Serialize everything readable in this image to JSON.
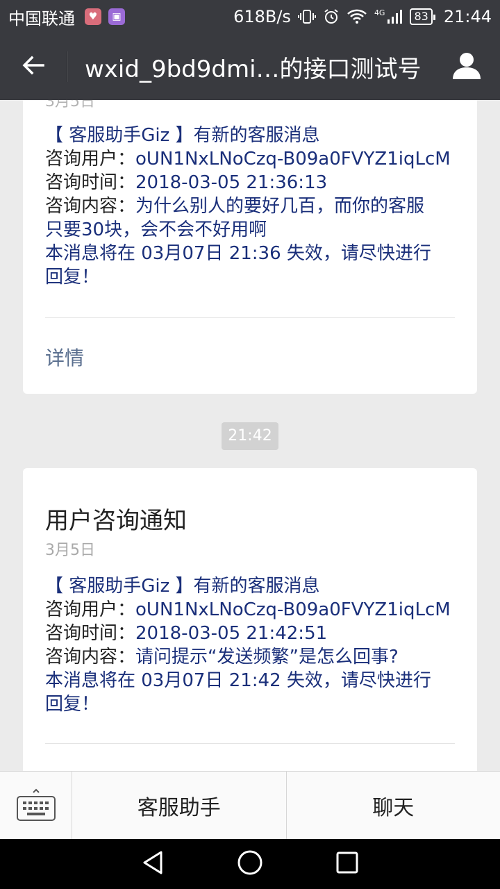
{
  "status_bar": {
    "carrier": "中国联通",
    "net_speed": "618B/s",
    "network": "4G",
    "battery": "83",
    "time": "21:44"
  },
  "header": {
    "title": "wxid_9bd9dmi…的接口测试号"
  },
  "card1": {
    "clipped_date": "3月5日",
    "headline": "【 客服助手Giz 】有新的客服消息",
    "user_label": "咨询用户：",
    "user_value": "oUN1NxLNoCzq-B09a0FVYZ1iqLcM",
    "time_label": "咨询时间：",
    "time_value": "2018-03-05 21:36:13",
    "content_label": "咨询内容：",
    "content_value_1": "为什么别人的要好几百，而你的客服",
    "content_value_2": "只要30块，会不会不好用啊",
    "expire_1": "本消息将在 03月07日 21:36 失效，请尽快进行",
    "expire_2": "回复！",
    "detail": "详情"
  },
  "timestamp": "21:42",
  "card2": {
    "title": "用户咨询通知",
    "date": "3月5日",
    "headline": "【 客服助手Giz 】有新的客服消息",
    "user_label": "咨询用户：",
    "user_value": "oUN1NxLNoCzq-B09a0FVYZ1iqLcM",
    "time_label": "咨询时间：",
    "time_value": "2018-03-05 21:42:51",
    "content_label": "咨询内容：",
    "content_value": "请问提示“发送频繁”是怎么回事?",
    "expire_1": "本消息将在 03月07日 21:42 失效，请尽快进行",
    "expire_2": "回复！"
  },
  "bottom_menu": {
    "items": [
      "客服助手",
      "聊天"
    ]
  },
  "icons": {
    "back": "back-arrow-icon",
    "profile": "user-icon",
    "keyboard": "keyboard-icon",
    "nav_back": "triangle-back-icon",
    "nav_home": "circle-home-icon",
    "nav_recent": "square-recent-icon"
  },
  "colors": {
    "header_bg": "#393a3f",
    "message_text": "#1a2f7a",
    "background": "#ebebeb"
  }
}
